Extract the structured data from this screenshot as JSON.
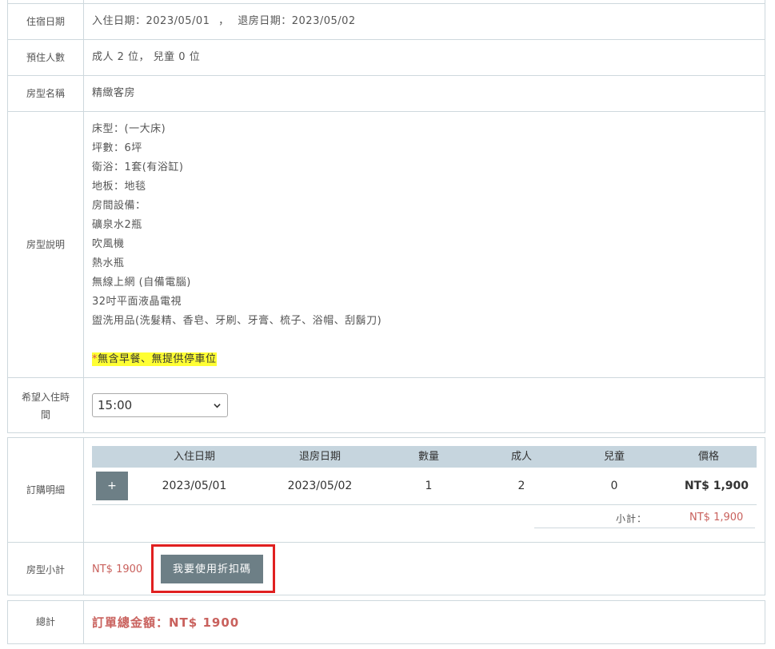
{
  "rows": {
    "stay_dates": {
      "label": "住宿日期",
      "checkin_label": "入住日期：",
      "checkin": "2023/05/01",
      "sep": "，",
      "checkout_label": "退房日期：",
      "checkout": "2023/05/02"
    },
    "guests": {
      "label": "預住人數",
      "value": "成人 2 位， 兒童 0 位"
    },
    "room_name": {
      "label": "房型名稱",
      "value": "精緻客房"
    },
    "room_desc": {
      "label": "房型說明",
      "lines": [
        "床型：(一大床)",
        "坪數：6坪",
        "衛浴：1套(有浴缸)",
        "地板：地毯",
        "房間設備：",
        "礦泉水2瓶",
        "吹風機",
        "熱水瓶",
        "無線上網 (自備電腦)",
        "32吋平面液晶電視",
        "盥洗用品(洗髮精、香皂、牙刷、牙膏、梳子、浴帽、刮鬍刀)"
      ],
      "note_star": "*",
      "note": "無含早餐、無提供停車位"
    },
    "checkin_time": {
      "label_line1": "希望入住時",
      "label_line2": "間",
      "selected": "15:00"
    }
  },
  "order": {
    "label": "訂購明細",
    "headers": [
      "入住日期",
      "退房日期",
      "數量",
      "成人",
      "兒童",
      "價格"
    ],
    "add_button": "+",
    "items": [
      {
        "checkin": "2023/05/01",
        "checkout": "2023/05/02",
        "qty": "1",
        "adults": "2",
        "children": "0",
        "price": "NT$ 1,900"
      }
    ],
    "subtotal_label": "小計：",
    "subtotal": "NT$ 1,900"
  },
  "room_subtotal": {
    "label": "房型小計",
    "amount": "NT$ 1900",
    "discount_button": "我要使用折扣碼"
  },
  "total": {
    "label": "總計",
    "value": "訂單總金額：NT$ 1900"
  },
  "colors": {
    "border": "#ced8dd",
    "header_bg": "#c6d5de",
    "button_bg": "#6d7f86",
    "price_red": "#c9615d",
    "highlight_yellow": "#ffff33",
    "annotation_red": "#e02020"
  },
  "icons": {
    "select_arrow": "chevron-down-icon"
  }
}
